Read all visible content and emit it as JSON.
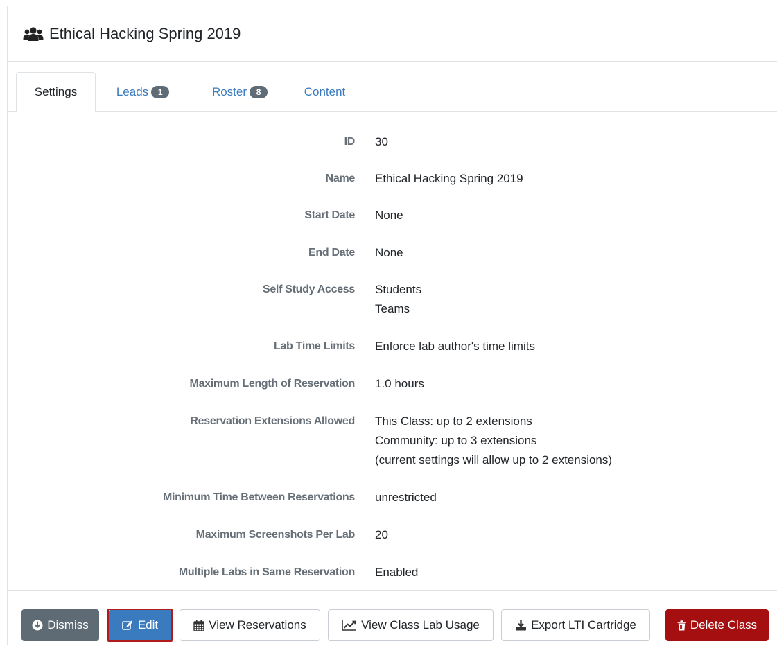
{
  "header": {
    "title": "Ethical Hacking Spring 2019",
    "icon": "users-icon"
  },
  "tabs": [
    {
      "label": "Settings",
      "active": true
    },
    {
      "label": "Leads",
      "badge": "1"
    },
    {
      "label": "Roster",
      "badge": "8"
    },
    {
      "label": "Content"
    }
  ],
  "settings": [
    {
      "label": "ID",
      "values": [
        "30"
      ]
    },
    {
      "label": "Name",
      "values": [
        "Ethical Hacking Spring 2019"
      ]
    },
    {
      "label": "Start Date",
      "values": [
        "None"
      ]
    },
    {
      "label": "End Date",
      "values": [
        "None"
      ]
    },
    {
      "label": "Self Study Access",
      "values": [
        "Students",
        "Teams"
      ]
    },
    {
      "label": "Lab Time Limits",
      "values": [
        "Enforce lab author's time limits"
      ]
    },
    {
      "label": "Maximum Length of Reservation",
      "values": [
        "1.0 hours"
      ]
    },
    {
      "label": "Reservation Extensions Allowed",
      "values": [
        "This Class: up to 2 extensions",
        "Community: up to 3 extensions",
        "(current settings will allow up to 2 extensions)"
      ]
    },
    {
      "label": "Minimum Time Between Reservations",
      "values": [
        "unrestricted"
      ]
    },
    {
      "label": "Maximum Screenshots Per Lab",
      "values": [
        "20"
      ]
    },
    {
      "label": "Multiple Labs in Same Reservation",
      "values": [
        "Enabled"
      ]
    }
  ],
  "footer": {
    "dismiss": "Dismiss",
    "edit": "Edit",
    "view_reservations": "View Reservations",
    "view_usage": "View Class Lab Usage",
    "export_lti": "Export LTI Cartridge",
    "delete": "Delete Class"
  },
  "colors": {
    "primary": "#3a7bbf",
    "secondary": "#5e6a74",
    "danger": "#a50f0f",
    "highlight_border": "#b01c1c"
  }
}
